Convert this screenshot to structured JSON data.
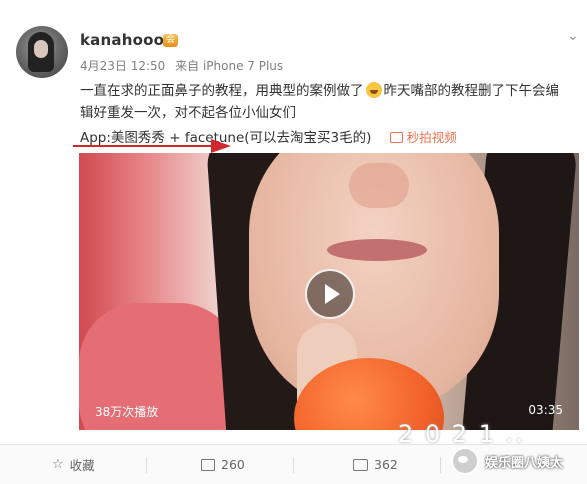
{
  "post": {
    "username": "kanahoooo",
    "vip_badge": "会",
    "date": "4月23日 12:50",
    "source": "来自 iPhone 7 Plus",
    "text_line1_part1": "一直在求的正面鼻子的教程，用典型的案例做了",
    "text_line1_part2": "昨天嘴部的教程删了下午会编",
    "text_line2": "辑好重发一次，对不起各位小仙女们",
    "app_line": "App:美图秀秀 + facetune(可以去淘宝买3毛的)",
    "video_link": "秒拍视频"
  },
  "video": {
    "views": "38万次播放",
    "duration": "03:35"
  },
  "overlay_text": "2 0 2 1 ..",
  "actions": {
    "favorite_label": "收藏",
    "repost_count": "260",
    "comment_count": "362"
  },
  "watermark": {
    "label": "娱乐圈八姨太"
  },
  "colors": {
    "accent": "#eb7350",
    "annotation_red": "#d0282c"
  }
}
